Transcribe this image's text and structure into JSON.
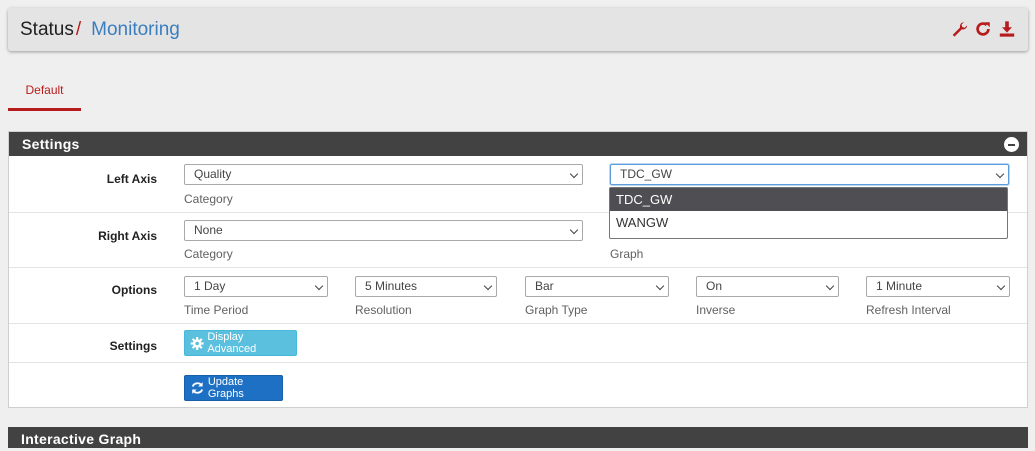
{
  "breadcrumb": {
    "section": "Status",
    "separator": "/",
    "page": "Monitoring"
  },
  "header_icons": [
    "wrench-icon",
    "refresh-icon",
    "download-icon"
  ],
  "tabs": [
    {
      "label": "Default",
      "active": true
    }
  ],
  "settings_panel": {
    "title": "Settings",
    "left_axis": {
      "label": "Left Axis",
      "category_value": "Quality",
      "category_help": "Category",
      "graph_value": "TDC_GW"
    },
    "right_axis": {
      "label": "Right Axis",
      "category_value": "None",
      "category_help": "Category",
      "graph_help": "Graph"
    },
    "options": {
      "label": "Options",
      "time_period": {
        "value": "1 Day",
        "help": "Time Period"
      },
      "resolution": {
        "value": "5 Minutes",
        "help": "Resolution"
      },
      "graph_type": {
        "value": "Bar",
        "help": "Graph Type"
      },
      "inverse": {
        "value": "On",
        "help": "Inverse"
      },
      "refresh_interval": {
        "value": "1 Minute",
        "help": "Refresh Interval"
      }
    },
    "settings_row": {
      "label": "Settings",
      "display_advanced": "Display Advanced"
    },
    "update_graphs": "Update Graphs"
  },
  "graph_dropdown": {
    "options": [
      "TDC_GW",
      "WANGW"
    ],
    "highlighted": "TDC_GW"
  },
  "interactive_panel": {
    "title": "Interactive Graph"
  },
  "colors": {
    "accent": "#b71c1c",
    "link": "#3b7ec0",
    "panel_head": "#424242",
    "info": "#5bc0de",
    "primary": "#1e70c4"
  }
}
